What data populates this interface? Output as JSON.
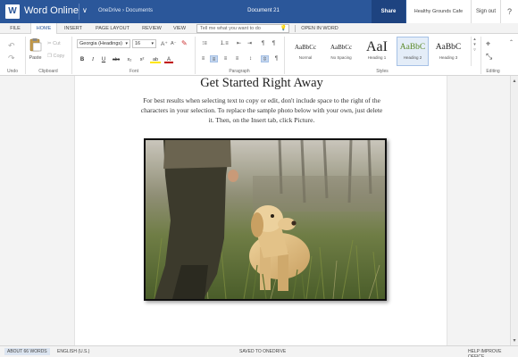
{
  "titlebar": {
    "logo": "W",
    "app_name": "Word Online",
    "chevron": "∨",
    "breadcrumb": "OneDrive › Documents",
    "doc_name": "Document 21",
    "share_label": "Share",
    "user_name": "Healthy Grounds Cafe",
    "signout_label": "Sign out",
    "help_label": "?"
  },
  "tabs": [
    {
      "label": "FILE"
    },
    {
      "label": "HOME"
    },
    {
      "label": "INSERT"
    },
    {
      "label": "PAGE LAYOUT"
    },
    {
      "label": "REVIEW"
    },
    {
      "label": "VIEW"
    }
  ],
  "tell_me": {
    "placeholder": "Tell me what you want to do",
    "icon": "lightbulb-icon"
  },
  "open_in_word_label": "OPEN IN WORD",
  "ribbon": {
    "undo": {
      "undo_icon": "↶",
      "redo_icon": "↷",
      "label": "Undo"
    },
    "clipboard": {
      "paste_label": "Paste",
      "cut_label": "Cut",
      "copy_label": "Copy",
      "label": "Clipboard"
    },
    "font": {
      "font_name": "Georgia (Headings)",
      "font_size": "16",
      "grow": "A⁺",
      "shrink": "A⁻",
      "bold": "B",
      "italic": "I",
      "underline": "U",
      "strike": "abc",
      "subscript": "x₂",
      "superscript": "x²",
      "highlight": "ab",
      "color": "A",
      "label": "Font"
    },
    "paragraph": {
      "label": "Paragraph"
    },
    "styles": {
      "label": "Styles",
      "items": [
        {
          "preview": "AaBbCc",
          "name": "Normal"
        },
        {
          "preview": "AaBbCc",
          "name": "No Spacing"
        },
        {
          "preview": "AaI",
          "name": "Heading 1"
        },
        {
          "preview": "AaBbC",
          "name": "Heading 2"
        },
        {
          "preview": "AaBbC",
          "name": "Heading 3"
        }
      ]
    },
    "editing": {
      "label": "Editing"
    }
  },
  "document": {
    "title": "Get Started Right Away",
    "body": "For best results when selecting text to copy or edit, don't include space to the right of the characters in your selection. To replace the sample photo below with your own, just delete it. Then, on the Insert tab, click Picture."
  },
  "statusbar": {
    "words": "ABOUT 66 WORDS",
    "language": "ENGLISH (U.S.)",
    "saved": "SAVED TO ONEDRIVE",
    "help": "HELP IMPROVE OFFICE"
  },
  "colors": {
    "brand": "#2b579a",
    "share_bg": "#1e4380"
  }
}
